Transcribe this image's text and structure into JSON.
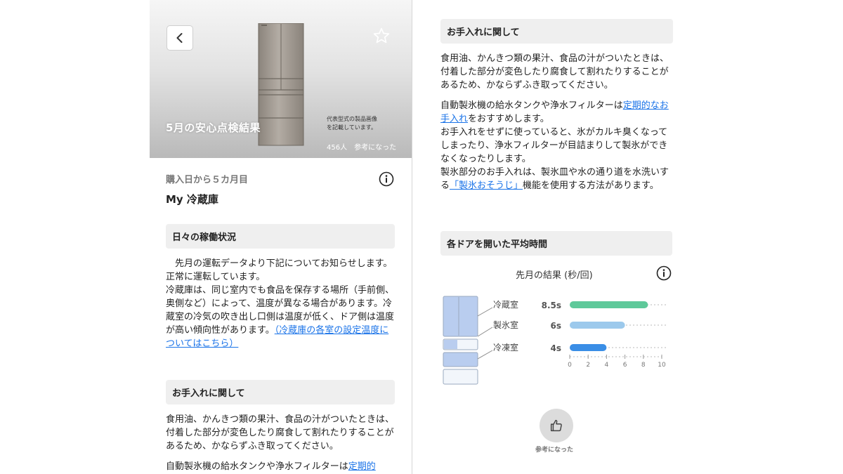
{
  "hero": {
    "title": "5月の安心点検結果",
    "image_note_line1": "代表型式の製品画像",
    "image_note_line2": "を記載しています。",
    "helpful_count": "456人",
    "helpful_label": "参考になった"
  },
  "product": {
    "purchase_elapsed": "購入日から５カ月目",
    "name": "My 冷蔵庫"
  },
  "daily_status": {
    "heading": "日々の稼働状況",
    "line1": "　先月の運転データより下記についてお知らせします。",
    "line2": "正常に運転しています。",
    "line3": "冷蔵庫は、同じ室内でも食品を保存する場所（手前側、奥側など）によって、温度が異なる場合があります。冷蔵室の冷気の吹き出し口側は温度が低く、ドア側は温度が高い傾向性があります。",
    "link": "（冷蔵庫の各室の設定温度についてはこちら）"
  },
  "care": {
    "heading": "お手入れに関して",
    "para1": "食用油、かんきつ類の果汁、食品の汁がついたときは、付着した部分が変色したり腐食して割れたりすることがあるため、かならずふき取ってください。",
    "para2_before": "自動製氷機の給水タンクや浄水フィルターは",
    "para2_link": "定期的なお手入れ",
    "para2_after": "をおすすめします。",
    "para3": "お手入れをせずに使っていると、氷がカルキ臭くなってしまったり、浄水フィルターが目詰まりして製氷ができなくなったりします。",
    "para4_before": "製氷部分のお手入れは、製氷皿や水の通り道を水洗いする",
    "para4_link": "「製氷おそうじ」",
    "para4_after": "機能を使用する方法があります。",
    "left_partial_before": "自動製氷機の給水タンクや浄水フィルターは",
    "left_partial_link": "定期的"
  },
  "door_time": {
    "heading": "各ドアを開いた平均時間",
    "subtitle": "先月の結果 (秒/回)"
  },
  "chart_data": {
    "type": "bar",
    "orientation": "horizontal",
    "categories": [
      "冷蔵室",
      "製氷室",
      "冷凍室"
    ],
    "values": [
      8.5,
      6,
      4
    ],
    "value_labels": [
      "8.5s",
      "6s",
      "4s"
    ],
    "xlim": [
      0,
      10
    ],
    "xticks": [
      0,
      2,
      4,
      6,
      8,
      10
    ],
    "colors": [
      "#5ec99a",
      "#9cc9ec",
      "#3a8ee6"
    ],
    "grid": "dotted"
  },
  "feedback": {
    "label": "参考になった"
  },
  "icons": {
    "back": "chevron-left-icon",
    "favorite": "star-outline-icon",
    "info": "info-circle-icon",
    "like": "thumbs-up-icon"
  }
}
